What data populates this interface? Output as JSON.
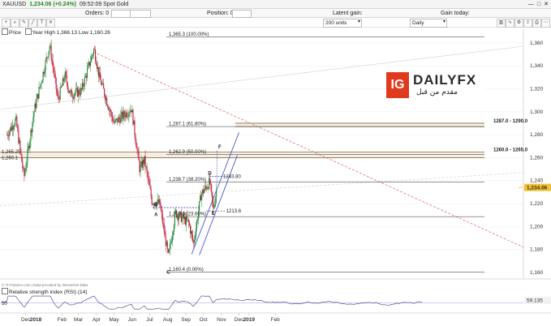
{
  "header": {
    "symbol": "XAUUSD",
    "price_change": "1,234.06 (+0.24%)",
    "time_title": "09:52:09 Spot Gold"
  },
  "orders_bar": {
    "orders_label": "Orders: 0",
    "position_label": "Position: 0",
    "latent_gain_label": "Latent gain:",
    "gain_today_label": "Gain today:",
    "units_value": "200 units",
    "timeframe_value": "Daily"
  },
  "price_legend": "Price",
  "year_stats": "Year High 1,366.13 Low 1,160.26",
  "rsi_legend": "Relative strength index (RSI) (14)",
  "rsi_level": "50",
  "rsi_value": "59.135",
  "copyright": "© IT-Finance.com | Data provided by Interactive Data",
  "current_price": "1,234.06",
  "colors": {
    "up_candle": "#1f8a3a",
    "down_candle": "#c41e3a",
    "fib_line": "#555555",
    "zone_line": "#8a6d3b",
    "trend_blue": "#4b55cc",
    "trend_red_dashed": "#e07070",
    "price_tag": "#f2c12e",
    "logo_red": "#e03a1e"
  },
  "logo": {
    "badge": "IG",
    "brand": "DAILYFX",
    "tagline": "مقدم من قبل"
  },
  "chart_data": {
    "type": "candlestick",
    "y_axis": {
      "min": 1150,
      "max": 1375,
      "ticks": [
        "1,360",
        "1,340",
        "1,320",
        "1,300",
        "1,280",
        "1,260",
        "1,240",
        "1,220",
        "1,200",
        "1,180",
        "1,160"
      ]
    },
    "x_axis_labels": [
      "Dec",
      "2018",
      "Feb",
      "Mar",
      "Apr",
      "May",
      "Jun",
      "Jul",
      "Aug",
      "Sep",
      "Oct",
      "Nov",
      "Dec",
      "2019",
      "Feb"
    ],
    "fib_levels": [
      {
        "label": "1,365.3 (100.00%)",
        "value": 1365.3
      },
      {
        "label": "1,287.1 (61.80%)",
        "value": 1287.1
      },
      {
        "label": "1,262.9 (50.00%)",
        "value": 1262.9
      },
      {
        "label": "1,238.7 (38.20%)",
        "value": 1238.7
      },
      {
        "label": "1,208.6 (23.60%)",
        "value": 1208.6
      },
      {
        "label": "1,160.4 (0.00%)",
        "value": 1160.4
      }
    ],
    "zones": [
      {
        "label": "1287.0 - 1290.0",
        "low": 1287,
        "high": 1290
      },
      {
        "label": "1260.0 - 1265.0",
        "low": 1260,
        "high": 1265
      }
    ],
    "left_axis_labels": [
      "1,265.25",
      "1,260.1"
    ],
    "annotations": [
      {
        "label": "1243.80",
        "value": 1243.8
      },
      {
        "label": "1213.6",
        "value": 1213.6
      }
    ],
    "point_labels": [
      {
        "label": "A",
        "date": "2018-07-26",
        "value": 1209
      },
      {
        "label": "B",
        "date": "2018-07-26",
        "value": 1218
      },
      {
        "label": "C",
        "date": "2018-08-16",
        "value": 1159
      },
      {
        "label": "D",
        "date": "2018-10-26",
        "value": 1245
      },
      {
        "label": "E",
        "date": "2018-11-01",
        "value": 1210
      },
      {
        "label": "F",
        "date": "2018-11-12",
        "value": 1268
      }
    ],
    "rsi": {
      "level": 50,
      "value": 59.135
    }
  }
}
